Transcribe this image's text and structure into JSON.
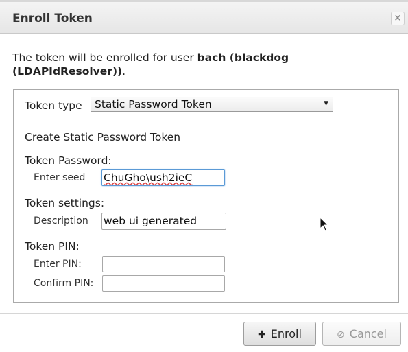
{
  "dialog": {
    "title": "Enroll Token",
    "close_icon": "×"
  },
  "intro": {
    "prefix": "The token will be enrolled for user ",
    "user": "bach (blackdog",
    "resolver": "(LDAPIdResolver))",
    "suffix": "."
  },
  "token_type": {
    "label": "Token type",
    "selected": "Static Password Token",
    "arrow_icon": "▼"
  },
  "form": {
    "heading": "Create Static Password Token",
    "password_section": "Token Password:",
    "seed_label": "Enter seed",
    "seed_value": "ChuGho\\ush2ieC",
    "settings_section": "Token settings:",
    "description_label": "Description",
    "description_value": "web ui generated",
    "pin_section": "Token PIN:",
    "enter_pin_label": "Enter PIN:",
    "enter_pin_value": "",
    "confirm_pin_label": "Confirm PIN:",
    "confirm_pin_value": ""
  },
  "buttons": {
    "enroll_label": "Enroll",
    "enroll_icon": "✚",
    "cancel_label": "Cancel",
    "cancel_icon": "⊘"
  }
}
